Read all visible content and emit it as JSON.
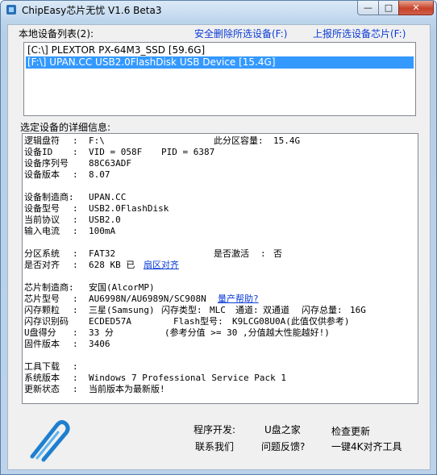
{
  "window": {
    "title": "ChipEasy芯片无忧 V1.6 Beta3"
  },
  "top": {
    "device_list_label": "本地设备列表(2):",
    "delete_link": "安全删除所选设备(F:)",
    "report_link": "上报所选设备芯片(F:)"
  },
  "devices": [
    {
      "text": "[C:\\] PLEXTOR PX-64M3_SSD [59.6G]",
      "selected": false
    },
    {
      "text": "[F:\\] UPAN.CC USB2.0FlashDisk USB Device [15.4G]",
      "selected": true
    }
  ],
  "details_label": "选定设备的详细信息:",
  "details": {
    "logical_drive": {
      "label": "逻辑盘符",
      "value": "F:\\"
    },
    "partition_capacity": {
      "label": "此分区容量:",
      "value": "15.4G"
    },
    "device_id": {
      "label": "设备ID",
      "vid": "VID = 058F",
      "pid": "PID = 6387"
    },
    "serial": {
      "label": "设备序列号",
      "value": "88C63ADF"
    },
    "version": {
      "label": "设备版本",
      "value": "8.07"
    },
    "manufacturer": {
      "label": "设备制造商:",
      "value": "UPAN.CC"
    },
    "model": {
      "label": "设备型号",
      "value": "USB2.0FlashDisk"
    },
    "protocol": {
      "label": "当前协议",
      "value": "USB2.0"
    },
    "current": {
      "label": "输入电流",
      "value": "100mA"
    },
    "fs": {
      "label": "分区系统",
      "value": "FAT32"
    },
    "active": {
      "label": "是否激活",
      "value": "否"
    },
    "aligned": {
      "label": "是否对齐",
      "value": "628 KB 已",
      "link": "扇区对齐"
    },
    "chip_vendor": {
      "label": "芯片制造商:",
      "value": "安国(AlcorMP)"
    },
    "chip_model": {
      "label": "芯片型号",
      "value": "AU6998N/AU6989N/SC908N",
      "link": "量产帮助?"
    },
    "flash": {
      "label": "闪存颗粒",
      "value": "三星(Samsung)",
      "type_label": "闪存类型:",
      "type": "MLC",
      "channel_label": "通道:",
      "channel": "双通道",
      "total_label": "闪存总量:",
      "total": "16G"
    },
    "flash_id": {
      "label": "闪存识别码",
      "value": "ECDED57A",
      "model_label": "Flash型号:",
      "model": "K9LCG08U0A(此值仅供参考)"
    },
    "score": {
      "label": "U盘得分",
      "value": "33 分",
      "note": "(参考分值 >= 30 ,分值越大性能越好!)"
    },
    "firmware": {
      "label": "固件版本",
      "value": "3406"
    },
    "tools": {
      "label": "工具下载",
      "value": ""
    },
    "os": {
      "label": "系统版本",
      "value": "Windows 7 Professional Service Pack 1"
    },
    "update": {
      "label": "更新状态",
      "value": "当前版本为最新版!"
    }
  },
  "bottom": {
    "developer": "程序开发:",
    "upan_home": "U盘之家",
    "check_update": "检查更新",
    "contact": "联系我们",
    "feedback": "问题反馈?",
    "align_tool": "一键4K对齐工具"
  },
  "colors": {
    "accent": "#3399ff",
    "link": "#0a3bd6"
  }
}
